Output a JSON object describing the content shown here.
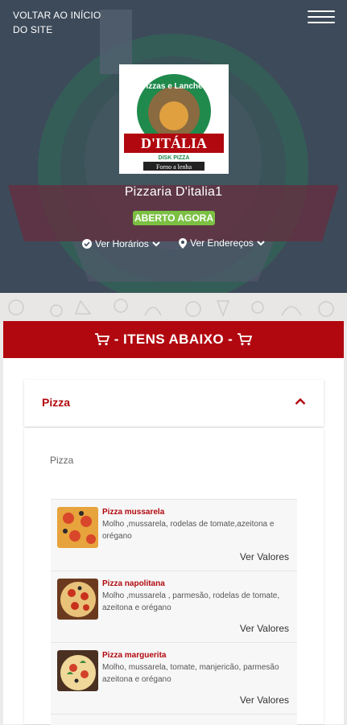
{
  "header": {
    "back_link": "VOLTAR AO INÍCIO DO SITE",
    "menu_icon": "hamburger-menu-icon"
  },
  "store": {
    "logo_top_text": "Pizzas e Lanches",
    "logo_brand": "D'ITÁLIA",
    "logo_sub": "DISK PIZZA",
    "logo_bottom": "Forno a lenha",
    "name": "Pizzaria D'italia1",
    "status": "ABERTO AGORA",
    "hours_link": "Ver Horários",
    "address_link": "Ver Endereços"
  },
  "section": {
    "banner": "- ITENS ABAIXO -"
  },
  "category": {
    "title": "Pizza",
    "description": "Pizza"
  },
  "products": [
    {
      "name": "Pizza mussarela",
      "description": "Molho ,mussarela, rodelas de tomate,azeitona e orégano",
      "action": "Ver Valores"
    },
    {
      "name": "Pizza napolitana",
      "description": "Molho ,mussarela , parmesão, rodelas de tomate, azeitona e orégano",
      "action": "Ver Valores"
    },
    {
      "name": "Pizza marguerita",
      "description": "Molho, mussarela, tomate, manjericão, parmesão azeitona e orégano",
      "action": "Ver Valores"
    }
  ],
  "colors": {
    "accent": "#b1080f",
    "open_badge": "#7bc043",
    "hero_bg": "#3d4a5a"
  }
}
